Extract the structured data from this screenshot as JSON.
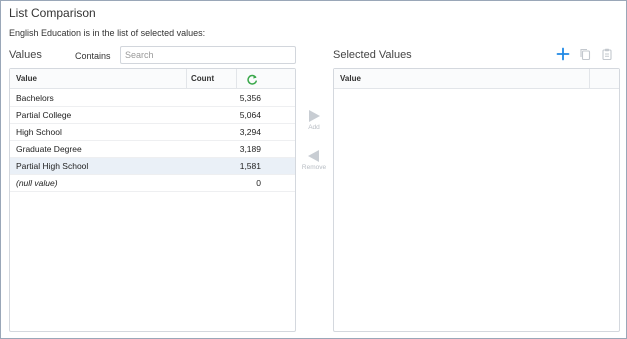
{
  "title": "List Comparison",
  "description": "English Education is in the list of selected values:",
  "values_section": {
    "heading": "Values",
    "contains_label": "Contains",
    "search_placeholder": "Search",
    "search_value": "",
    "columns": {
      "value": "Value",
      "count": "Count"
    },
    "rows": [
      {
        "value": "Bachelors",
        "count": "5,356"
      },
      {
        "value": "Partial College",
        "count": "5,064"
      },
      {
        "value": "High School",
        "count": "3,294"
      },
      {
        "value": "Graduate Degree",
        "count": "3,189"
      },
      {
        "value": "Partial High School",
        "count": "1,581"
      },
      {
        "value": "(null value)",
        "count": "0"
      }
    ]
  },
  "movers": {
    "add_label": "Add",
    "remove_label": "Remove"
  },
  "selected_section": {
    "heading": "Selected Values",
    "columns": {
      "value": "Value"
    }
  },
  "icons": {
    "refresh": "refresh-icon",
    "add": "plus-icon",
    "copy": "copy-icon",
    "paste": "clipboard-icon",
    "move_right": "triangle-right-icon",
    "move_left": "triangle-left-icon"
  },
  "colors": {
    "accent_blue": "#1e88e5",
    "refresh_green": "#3aa84b",
    "row_highlight": "#eaf0f7",
    "disabled_gray": "#c8cdd3"
  }
}
